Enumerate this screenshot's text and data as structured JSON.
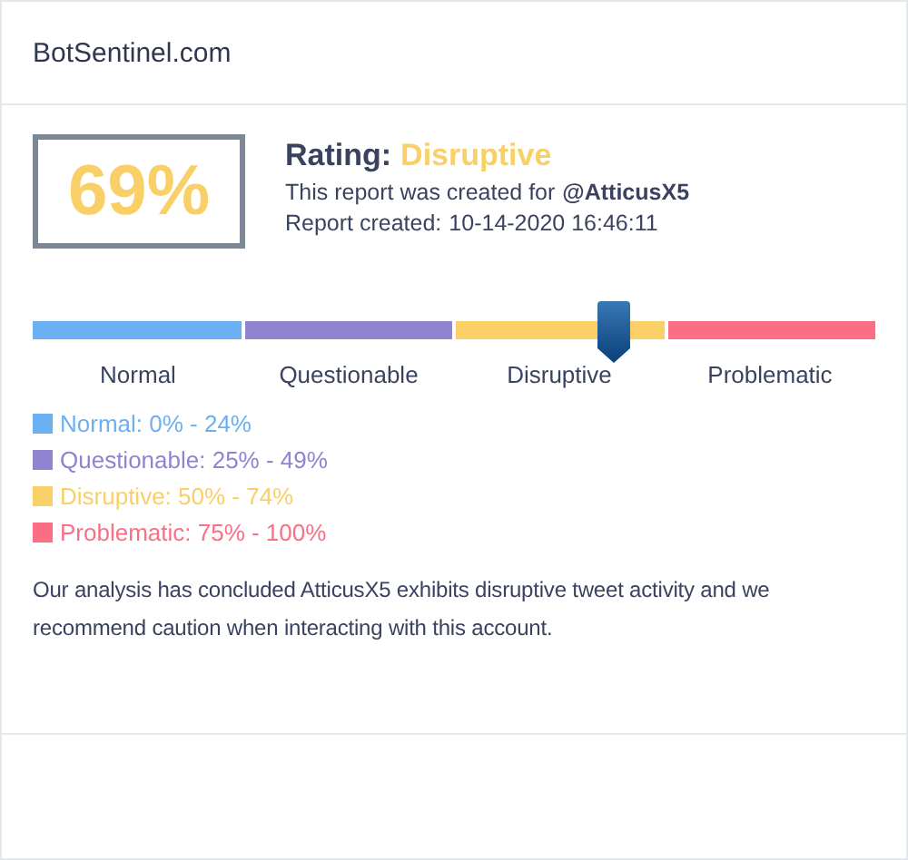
{
  "header": {
    "title": "BotSentinel.com"
  },
  "score": {
    "value": "69%",
    "rating_label": "Rating:",
    "rating_value": "Disruptive",
    "report_for_text": "This report was created for",
    "handle": "@AtticusX5",
    "created_label": "Report created:",
    "created_value": "10-14-2020 16:46:11"
  },
  "meter": {
    "level": 0.69,
    "segments": [
      {
        "label": "Normal",
        "color": "#6ab0f3"
      },
      {
        "label": "Questionable",
        "color": "#9183cf"
      },
      {
        "label": "Disruptive",
        "color": "#f9d068"
      },
      {
        "label": "Problematic",
        "color": "#fc6e86"
      }
    ]
  },
  "legend": [
    {
      "text": "Normal: 0% - 24%",
      "color": "#6ab0f3"
    },
    {
      "text": "Questionable: 25% - 49%",
      "color": "#9183cf"
    },
    {
      "text": "Disruptive: 50% - 74%",
      "color": "#f9d068"
    },
    {
      "text": "Problematic: 75% - 100%",
      "color": "#fc6e86"
    }
  ],
  "summary": "Our analysis has concluded AtticusX5 exhibits disruptive tweet activity and we recommend caution when interacting with this account."
}
